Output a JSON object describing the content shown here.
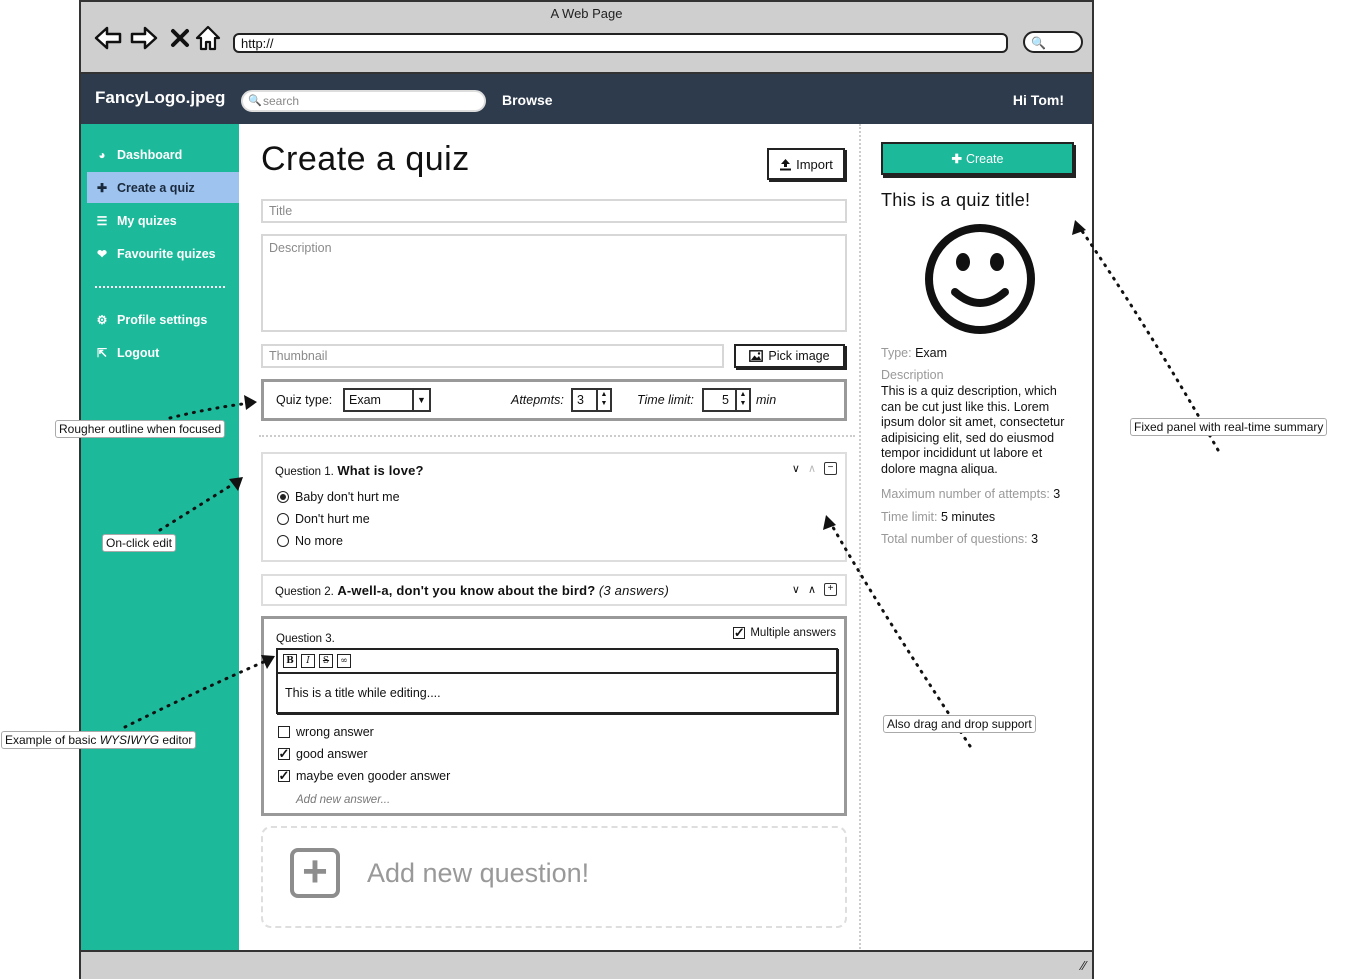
{
  "browser": {
    "window_title": "A Web Page",
    "address": "http://"
  },
  "app_header": {
    "logo": "FancyLogo.jpeg",
    "search_placeholder": "search",
    "browse": "Browse",
    "greeting": "Hi Tom!"
  },
  "sidebar": {
    "items": [
      {
        "label": "Dashboard",
        "icon": "dashboard-icon"
      },
      {
        "label": "Create a quiz",
        "icon": "plus-icon",
        "active": true
      },
      {
        "label": "My quizes",
        "icon": "list-icon"
      },
      {
        "label": "Favourite quizes",
        "icon": "heart-icon"
      },
      {
        "label": "Profile settings",
        "icon": "gear-icon"
      },
      {
        "label": "Logout",
        "icon": "logout-icon"
      }
    ],
    "accent_color": "#1cb99a",
    "active_color": "#9fc3ef"
  },
  "main": {
    "title": "Create a quiz",
    "import_label": "Import",
    "title_placeholder": "Title",
    "description_placeholder": "Description",
    "thumbnail_placeholder": "Thumbnail",
    "pick_image_label": "Pick image",
    "settings": {
      "quiz_type_label": "Quiz type:",
      "quiz_type_value": "Exam",
      "attempts_label": "Attepmts:",
      "attempts_value": "3",
      "time_limit_label": "Time limit:",
      "time_limit_value": "5",
      "time_unit": "min"
    },
    "questions": [
      {
        "number": "Question 1.",
        "title": "What is love?",
        "answers": [
          {
            "text": "Baby don't hurt me",
            "selected": true
          },
          {
            "text": "Don't hurt me",
            "selected": false
          },
          {
            "text": "No more",
            "selected": false
          }
        ]
      },
      {
        "number": "Question 2.",
        "title": "A-well-a, don't you know about the bird?",
        "answer_count": "(3 answers)"
      },
      {
        "number": "Question 3.",
        "multiple_answers_label": "Multiple answers",
        "editor_text": "This is a title while editing....",
        "answers": [
          {
            "text": "wrong answer",
            "checked": false
          },
          {
            "text": "good answer",
            "checked": true
          },
          {
            "text": "maybe even gooder answer",
            "checked": true
          }
        ],
        "add_answer_placeholder": "Add new answer..."
      }
    ],
    "add_question_label": "Add new question!"
  },
  "panel": {
    "create_label": "Create",
    "quiz_title": "This is a quiz title!",
    "type_key": "Type:",
    "type_value": "Exam",
    "description_key": "Description",
    "description_text": "This is a quiz description, which can be cut just like this. Lorem ipsum dolor sit amet, consectetur adipisicing elit, sed do eiusmod tempor incididunt ut labore et dolore magna aliqua.",
    "max_attempts_key": "Maximum number of attempts:",
    "max_attempts_value": "3",
    "time_limit_key": "Time limit:",
    "time_limit_value": "5 minutes",
    "total_questions_key": "Total number of questions:",
    "total_questions_value": "3"
  },
  "annotations": {
    "rougher_outline": "Rougher outline when focused",
    "on_click_edit": "On-click edit",
    "wysiwyg_prefix": "Example of basic ",
    "wysiwyg_italic": "WYSIWYG",
    "wysiwyg_suffix": " editor",
    "fixed_panel": "Fixed panel with real-time summary",
    "drag_drop": "Also drag and drop support"
  }
}
